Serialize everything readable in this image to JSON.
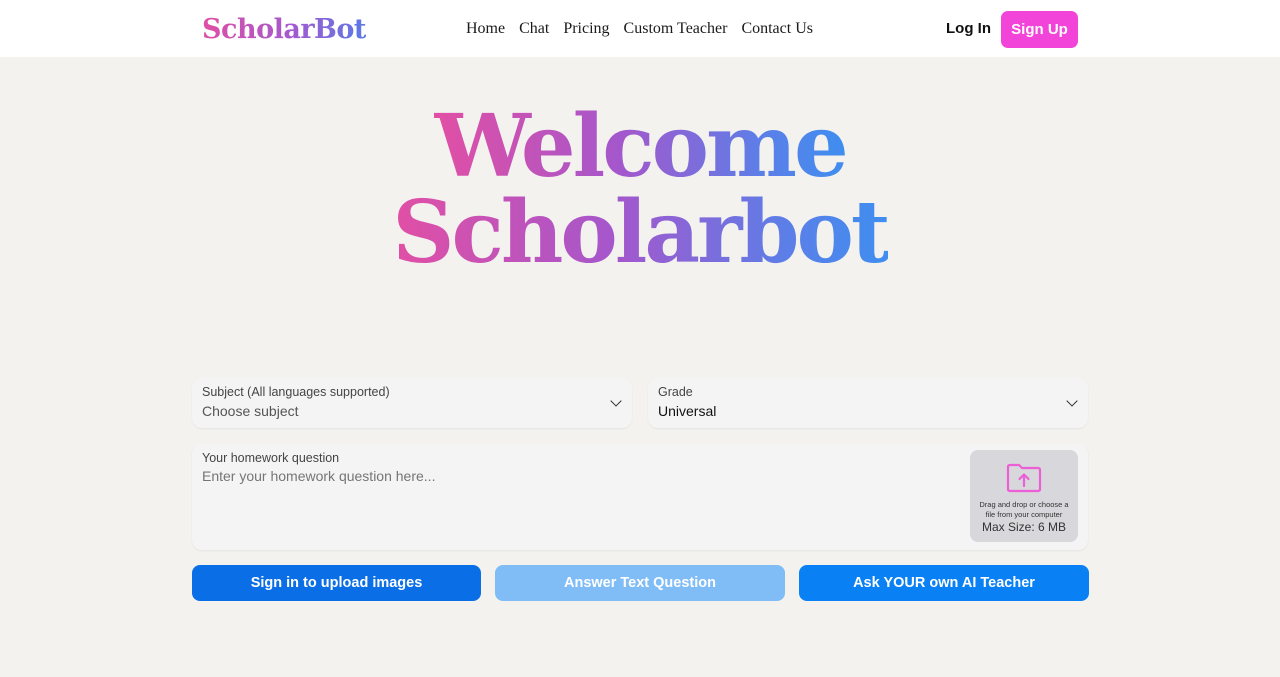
{
  "header": {
    "logo": "ScholarBot",
    "nav": [
      "Home",
      "Chat",
      "Pricing",
      "Custom Teacher",
      "Contact Us"
    ],
    "login_label": "Log In",
    "signup_label": "Sign Up"
  },
  "hero": {
    "line1": "Welcome",
    "line2": "Scholarbot"
  },
  "form": {
    "subject": {
      "label": "Subject (All languages supported)",
      "value": "Choose subject"
    },
    "grade": {
      "label": "Grade",
      "value": "Universal"
    },
    "question": {
      "label": "Your homework question",
      "placeholder": "Enter your homework question here..."
    },
    "upload": {
      "hint": "Drag and drop or choose a file from your computer",
      "max_size": "Max Size: 6 MB"
    }
  },
  "actions": {
    "upload_images": "Sign in to upload images",
    "answer_text": "Answer Text Question",
    "ask_teacher": "Ask YOUR own AI Teacher"
  },
  "colors": {
    "accent_pink": "#f244d8",
    "button_blue": "#0a6fe6",
    "button_disabled": "#80bdf6",
    "background": "#f3f2ef"
  }
}
